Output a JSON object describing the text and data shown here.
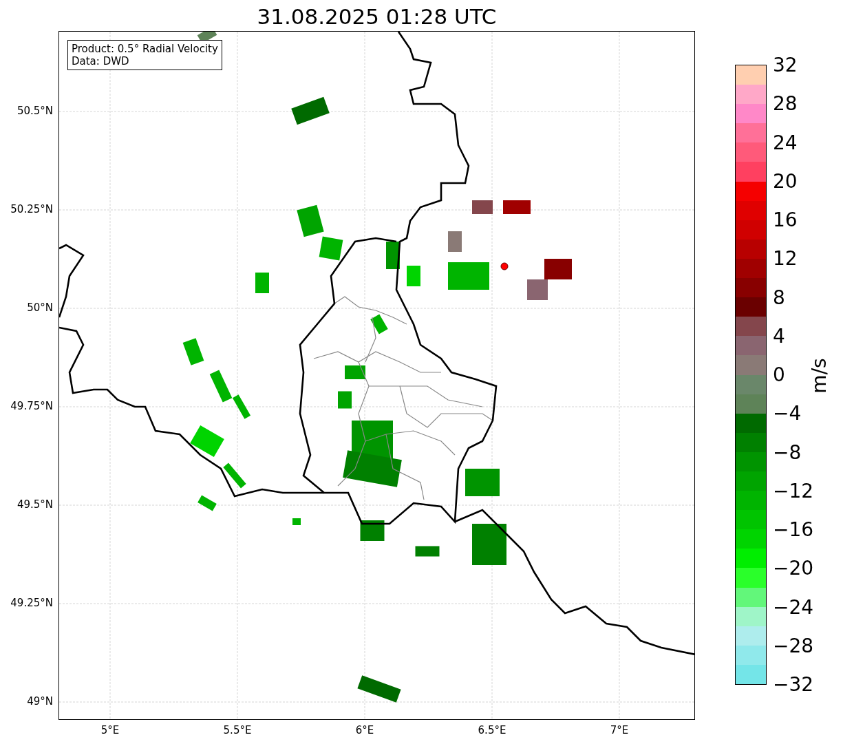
{
  "title": "31.08.2025 01:28 UTC",
  "legend": [
    "Product: 0.5° Radial Velocity",
    "Data: DWD"
  ],
  "map": {
    "lat_ticks": [
      "50.5°N",
      "50.25°N",
      "50°N",
      "49.75°N",
      "49.5°N",
      "49.25°N",
      "49°N"
    ],
    "lon_ticks": [
      "5°E",
      "5.5°E",
      "6°E",
      "6.5°E",
      "7°E"
    ]
  },
  "colorbar": {
    "label": "m/s",
    "ticks": [
      "32",
      "28",
      "24",
      "20",
      "16",
      "12",
      "8",
      "4",
      "0",
      "−4",
      "−8",
      "−12",
      "−16",
      "−20",
      "−24",
      "−28",
      "−32"
    ]
  }
}
